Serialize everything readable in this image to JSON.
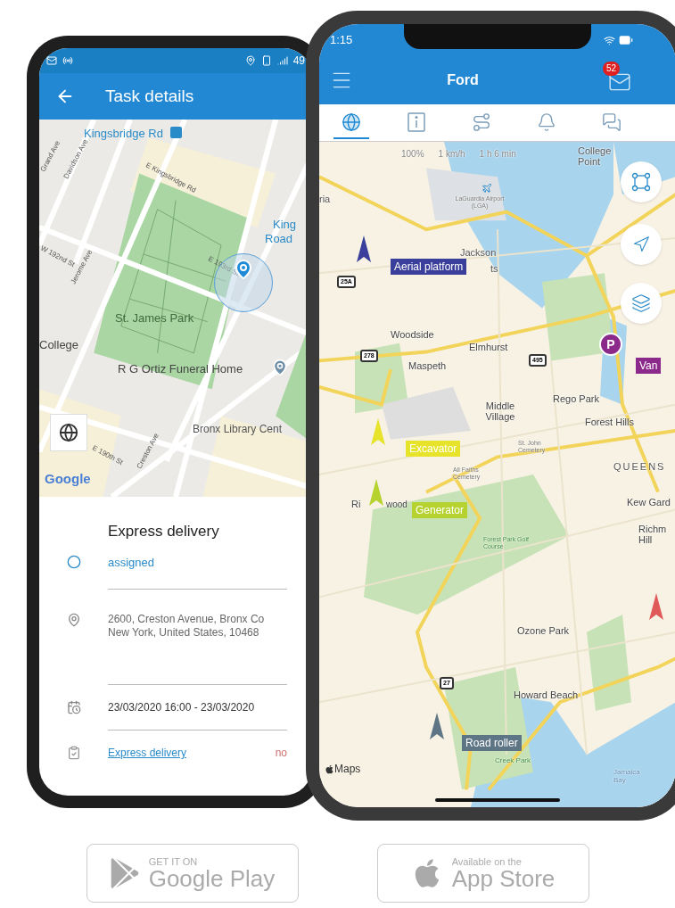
{
  "left_phone": {
    "status_bar": {
      "battery": "49"
    },
    "header": {
      "title": "Task details"
    },
    "map_labels": [
      "Kingsbridge Rd",
      "E Kingsbridge Rd",
      "Grand Ave",
      "Davidson Ave",
      "W 192nd St",
      "Jerome Ave",
      "E 193rd St",
      "King",
      "Road",
      "St. James Park",
      "College",
      "R G Ortiz Funeral Home",
      "Bronx Library Cent",
      "E 190th St",
      "Creston Ave"
    ],
    "map_logo": "Google",
    "task": {
      "title": "Express delivery",
      "status": "assigned",
      "address": [
        "2600, Creston Avenue, Bronx Co",
        "New York, United States, 10468"
      ],
      "period": "23/03/2020 16:00 - 23/03/2020",
      "link": "Express delivery",
      "state": "no"
    }
  },
  "right_phone": {
    "status_bar": {
      "time": "1:15"
    },
    "header": {
      "title": "Ford",
      "unread": "52"
    },
    "tabs": [
      {
        "kind": "globe",
        "selected": true
      },
      {
        "kind": "info",
        "selected": false
      },
      {
        "kind": "route",
        "selected": false
      },
      {
        "kind": "bell",
        "selected": false
      },
      {
        "kind": "chat",
        "selected": false
      }
    ],
    "stats": [
      "100%",
      "1 km/h",
      "1 h 6 min"
    ],
    "map_labels": [
      "College Point",
      "ria",
      "LaGuardia Airport (LGA)",
      "Jackson",
      "ts",
      "Woodside",
      "Elmhurst",
      "Maspeth",
      "Rego Park",
      "Middle Village",
      "Forest Hills",
      "St. John Cemetery",
      "All Faiths Cemetery",
      "QUEENS",
      "Kew Gard",
      "Richm Hill",
      "Ri",
      "wood",
      "Forest Park Golf Course",
      "Ozone Park",
      "Howard Beach",
      "Creek Park",
      "Jamaica Bay"
    ],
    "shields": [
      "25A",
      "278",
      "495",
      "27"
    ],
    "map_logo": "Maps",
    "vehicles": [
      {
        "label": "Aerial platform",
        "color": "#3b3f9c"
      },
      {
        "label": "Excavator",
        "color": "#e6e32a"
      },
      {
        "label": "Generator",
        "color": "#b6d22f"
      },
      {
        "color": "#e05a5a"
      },
      {
        "label": "Road roller",
        "color": "#5d7585"
      }
    ],
    "poi": {
      "letter": "P",
      "label": "Van",
      "color": "#8c2a8c"
    }
  },
  "store_buttons": [
    {
      "kind": "google",
      "top": "GET IT ON",
      "bottom": "Google Play"
    },
    {
      "kind": "apple",
      "top": "Available on the",
      "bottom": "App Store"
    }
  ]
}
